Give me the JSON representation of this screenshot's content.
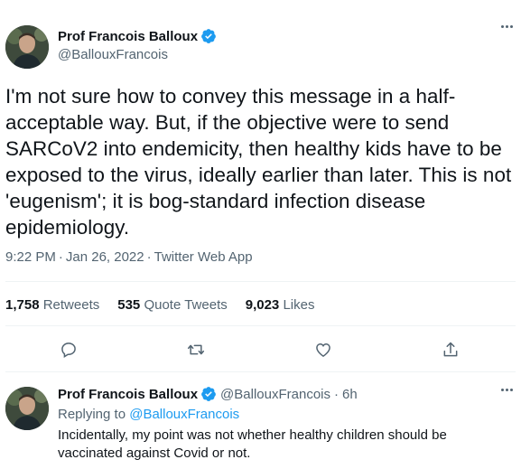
{
  "tweet": {
    "author": {
      "name": "Prof Francois Balloux",
      "handle": "@BallouxFrancois",
      "verified_icon": "verified-badge-icon",
      "avatar_icon": "avatar-photo"
    },
    "text": "I'm not sure how to convey this message in a half-acceptable way. But, if the objective were to send SARCoV2 into endemicity, then healthy kids have to be exposed to the virus, ideally earlier than later. This is not 'eugenism'; it is bog-standard infection disease epidemiology.",
    "time": "9:22 PM",
    "date": "Jan 26, 2022",
    "source": "Twitter Web App",
    "meta_separator": "·",
    "stats": {
      "retweets_count": "1,758",
      "retweets_label": "Retweets",
      "quotes_count": "535",
      "quotes_label": "Quote Tweets",
      "likes_count": "9,023",
      "likes_label": "Likes"
    },
    "actions": [
      "reply-icon",
      "retweet-icon",
      "like-icon",
      "share-icon"
    ]
  },
  "reply": {
    "author": {
      "name": "Prof Francois Balloux",
      "handle": "@BallouxFrancois",
      "time_ago": "6h"
    },
    "replying_prefix": "Replying to",
    "replying_to": "@BallouxFrancois",
    "text": "Incidentally, my point was not whether healthy children should be vaccinated against Covid or not.",
    "separator": "·"
  },
  "colors": {
    "text": "#0f1419",
    "secondary": "#536471",
    "accent": "#1d9bf0",
    "divider": "#eff3f4"
  }
}
